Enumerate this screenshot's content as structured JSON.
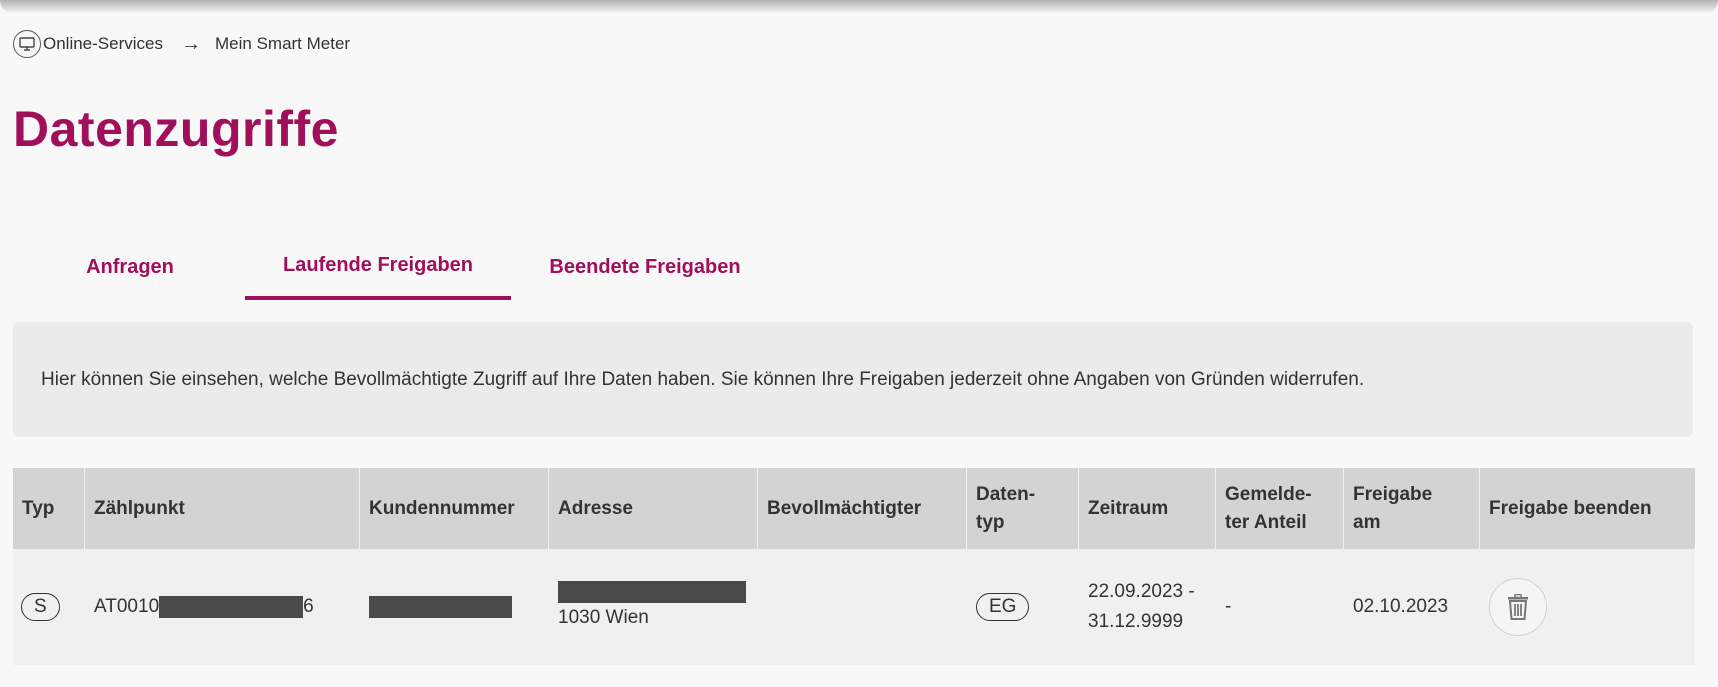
{
  "breadcrumb": {
    "home_icon": "monitor-icon",
    "item1": "Online-Services",
    "separator": "→",
    "item2": "Mein Smart Meter"
  },
  "page": {
    "title": "Datenzugriffe"
  },
  "tabs": [
    {
      "label": "Anfragen",
      "active": false
    },
    {
      "label": "Laufende Freigaben",
      "active": true
    },
    {
      "label": "Beendete Freigaben",
      "active": false
    }
  ],
  "info": "Hier können Sie einsehen, welche Bevollmächtigte Zugriff auf Ihre Daten haben. Sie können Ihre Freigaben jederzeit ohne Angaben von Gründen widerrufen.",
  "table": {
    "headers": {
      "typ": "Typ",
      "zaehlpunkt": "Zählpunkt",
      "kundennummer": "Kundennummer",
      "adresse": "Adresse",
      "bevollmaechtigter": "Bevollmächtigter",
      "datentyp_1": "Daten-",
      "datentyp_2": "typ",
      "zeitraum": "Zeitraum",
      "anteil_1": "Gemelde-",
      "anteil_2": "ter Anteil",
      "freigabe_am_1": "Freigabe",
      "freigabe_am_2": "am",
      "beenden": "Freigabe beenden"
    },
    "rows": [
      {
        "typ": "S",
        "zaehlpunkt_prefix": "AT0010",
        "zaehlpunkt_suffix": "6",
        "adresse_city": "1030 Wien",
        "bevollmaechtigter": "",
        "datentyp": "EG",
        "zeitraum_1": "22.09.2023 -",
        "zeitraum_2": "31.12.9999",
        "anteil": "-",
        "freigabe_am": "02.10.2023",
        "delete_icon": "trash-icon"
      }
    ]
  },
  "colors": {
    "brand": "#a0105a",
    "header_bg": "#d3d3d3",
    "info_bg": "#ebebeb",
    "redaction": "#4a4a4a"
  }
}
